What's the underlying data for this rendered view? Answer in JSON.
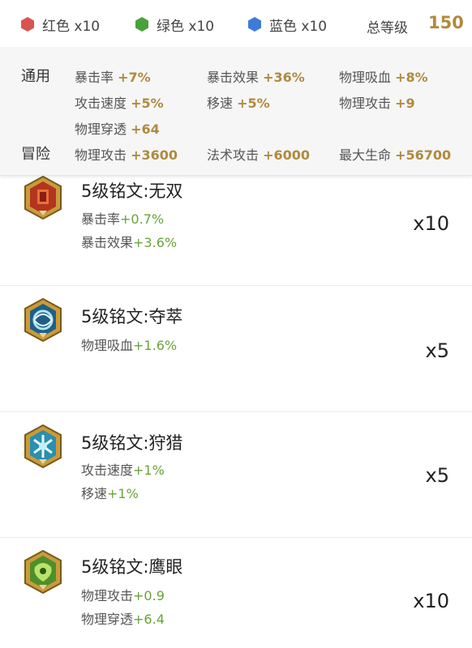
{
  "gems": [
    {
      "color": "#d9534f",
      "label": "红色 x10",
      "icon": "red-hexagon"
    },
    {
      "color": "#4aa13c",
      "label": "绿色 x10",
      "icon": "green-hexagon"
    },
    {
      "color": "#3d7bd9",
      "label": "蓝色 x10",
      "icon": "blue-hexagon"
    }
  ],
  "total": {
    "label": "总等级",
    "value": "150"
  },
  "general": {
    "label": "通用",
    "stats": [
      {
        "name": "暴击率",
        "value": "+7%"
      },
      {
        "name": "暴击效果",
        "value": "+36%"
      },
      {
        "name": "物理吸血",
        "value": "+8%"
      },
      {
        "name": "攻击速度",
        "value": "+5%"
      },
      {
        "name": "移速",
        "value": "+5%"
      },
      {
        "name": "物理攻击",
        "value": "+9"
      },
      {
        "name": "物理穿透",
        "value": "+64"
      }
    ]
  },
  "adventure": {
    "label": "冒险",
    "stats": [
      {
        "name": "物理攻击",
        "value": "+3600"
      },
      {
        "name": "法术攻击",
        "value": "+6000"
      },
      {
        "name": "最大生命",
        "value": "+56700"
      }
    ]
  },
  "runes": [
    {
      "title": "5级铭文:无双",
      "icon": "red-rune-icon",
      "stats": [
        {
          "name": "暴击率",
          "value": "+0.7%"
        },
        {
          "name": "暴击效果",
          "value": "+3.6%"
        }
      ],
      "count": "x10"
    },
    {
      "title": "5级铭文:夺萃",
      "icon": "blue-rune-icon",
      "stats": [
        {
          "name": "物理吸血",
          "value": "+1.6%"
        }
      ],
      "count": "x5"
    },
    {
      "title": "5级铭文:狩猎",
      "icon": "blue-rune-icon",
      "stats": [
        {
          "name": "攻击速度",
          "value": "+1%"
        },
        {
          "name": "移速",
          "value": "+1%"
        }
      ],
      "count": "x5"
    },
    {
      "title": "5级铭文:鹰眼",
      "icon": "green-rune-icon",
      "stats": [
        {
          "name": "物理攻击",
          "value": "+0.9"
        },
        {
          "name": "物理穿透",
          "value": "+6.4"
        }
      ],
      "count": "x10"
    }
  ]
}
